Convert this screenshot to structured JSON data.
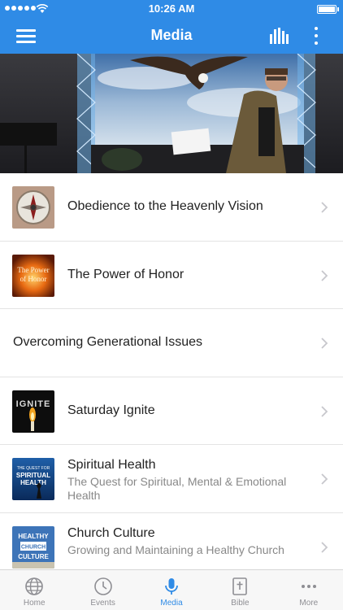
{
  "status_bar": {
    "time": "10:26 AM"
  },
  "nav": {
    "title": "Media"
  },
  "items": [
    {
      "title": "Obedience to the Heavenly Vision",
      "subtitle": ""
    },
    {
      "title": "The Power of Honor",
      "subtitle": "",
      "thumb_text": "The Power of Honor"
    },
    {
      "title": "Overcoming Generational Issues",
      "subtitle": ""
    },
    {
      "title": "Saturday Ignite",
      "subtitle": "",
      "thumb_text": "IGNITE"
    },
    {
      "title": "Spiritual Health",
      "subtitle": "The Quest for Spiritual, Mental & Emotional Health",
      "thumb_text_top": "THE QUEST FOR",
      "thumb_text_main": "SPIRITUAL HEALTH"
    },
    {
      "title": "Church Culture",
      "subtitle": "Growing and Maintaining a Healthy Church",
      "thumb_text_1": "HEALTHY",
      "thumb_text_2": "CHURCH",
      "thumb_text_3": "CULTURE"
    }
  ],
  "tabs": [
    {
      "label": "Home",
      "icon": "globe-icon"
    },
    {
      "label": "Events",
      "icon": "clock-icon"
    },
    {
      "label": "Media",
      "icon": "microphone-icon",
      "active": true
    },
    {
      "label": "Bible",
      "icon": "bible-icon"
    },
    {
      "label": "More",
      "icon": "more-icon"
    }
  ],
  "colors": {
    "accent": "#2f8be6",
    "inactive": "#8e8e93",
    "text": "#222222",
    "subtext": "#888888"
  }
}
